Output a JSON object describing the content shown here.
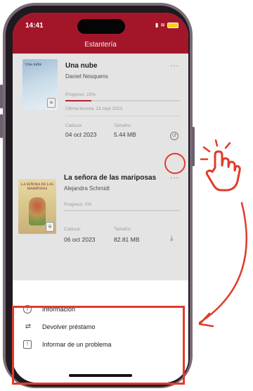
{
  "status_bar": {
    "time": "14:41"
  },
  "header": {
    "title": "Estantería"
  },
  "books": [
    {
      "title": "Una nube",
      "author": "Daniel Nesquens",
      "cover_title": "Una nube",
      "progress_label": "Progreso: 23%",
      "progress": 0.23,
      "last_read": "Última lectura: 13 sept 2023",
      "expires_label": "Caduca:",
      "expires_value": "04 oct 2023",
      "size_label": "Tamaño:",
      "size_value": "5.44 MB",
      "more": "···",
      "state_icon": "returned-icon"
    },
    {
      "title": "La señora de las mariposas",
      "author": "Alejandra Schmidt",
      "cover_title": "LA SEÑORA DE LAS MARIPOSAS",
      "progress_label": "Progreso: 0%",
      "progress": 0.0,
      "expires_label": "Caduca:",
      "expires_value": "06 oct 2023",
      "size_label": "Tamaño:",
      "size_value": "82.81 MB",
      "more": "···",
      "state_icon": "download-icon"
    }
  ],
  "sheet": {
    "items": [
      {
        "label": "Información",
        "icon": "info-icon"
      },
      {
        "label": "Devolver préstamo",
        "icon": "return-arrows-icon"
      },
      {
        "label": "Informar de un problema",
        "icon": "report-problem-icon"
      }
    ]
  },
  "colors": {
    "brand": "#a3162a",
    "highlight": "#e23b2b",
    "progress": "#b32033"
  }
}
